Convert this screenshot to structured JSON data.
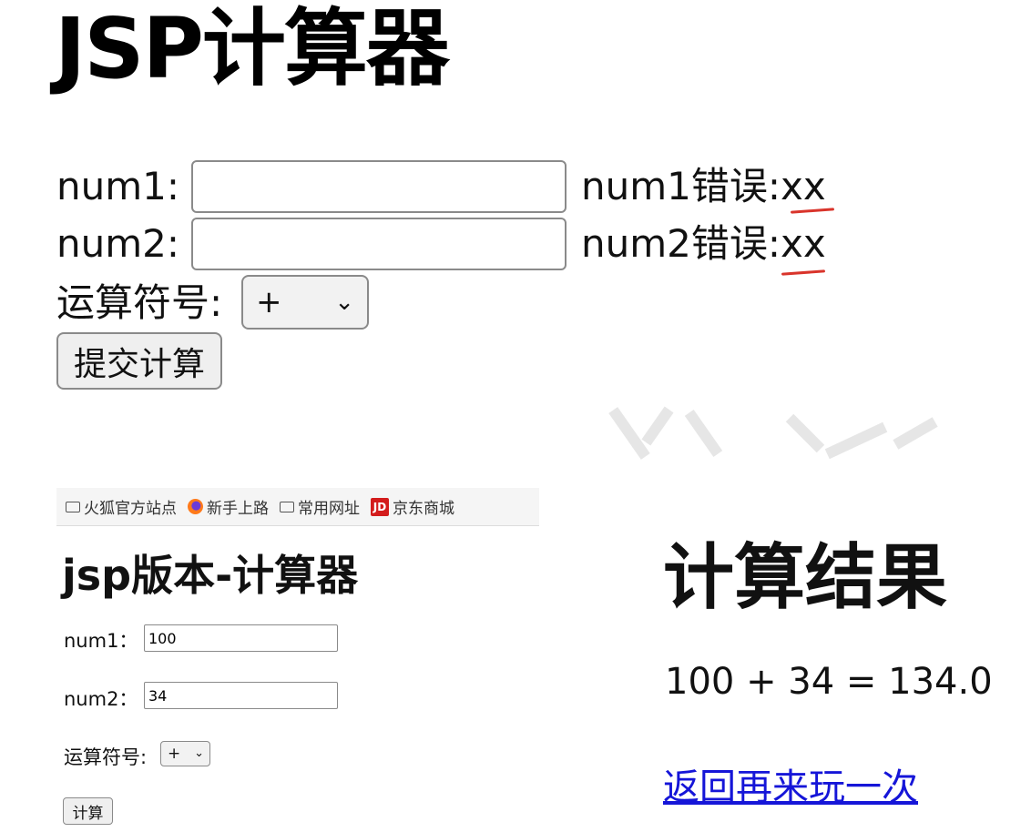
{
  "top_form": {
    "title": "JSP计算器",
    "num1_label": "num1:",
    "num1_value": "",
    "num1_error": "num1错误:xx",
    "num2_label": "num2:",
    "num2_value": "",
    "num2_error": "num2错误:xx",
    "operator_label": "运算符号:",
    "operator_value": "+",
    "submit_label": "提交计算"
  },
  "browser_screenshot": {
    "bookmarks": [
      {
        "label": "火狐官方站点",
        "icon": "folder-icon"
      },
      {
        "label": "新手上路",
        "icon": "firefox-icon"
      },
      {
        "label": "常用网址",
        "icon": "folder-icon"
      },
      {
        "label": "京东商城",
        "icon": "jd-icon",
        "icon_text": "JD"
      }
    ],
    "title": "jsp版本-计算器",
    "num1_label": "num1：",
    "num1_value": "100",
    "num2_label": "num2：",
    "num2_value": "34",
    "operator_label": "运算符号:",
    "operator_value": "+",
    "submit_label": "计算"
  },
  "result": {
    "title": "计算结果",
    "expression": "100 + 34 = 134.0",
    "link_label": "返回再来玩一次"
  },
  "colors": {
    "annotation_underline": "#d9342b",
    "link": "#1515d8",
    "jd_brand": "#d31c1c"
  }
}
